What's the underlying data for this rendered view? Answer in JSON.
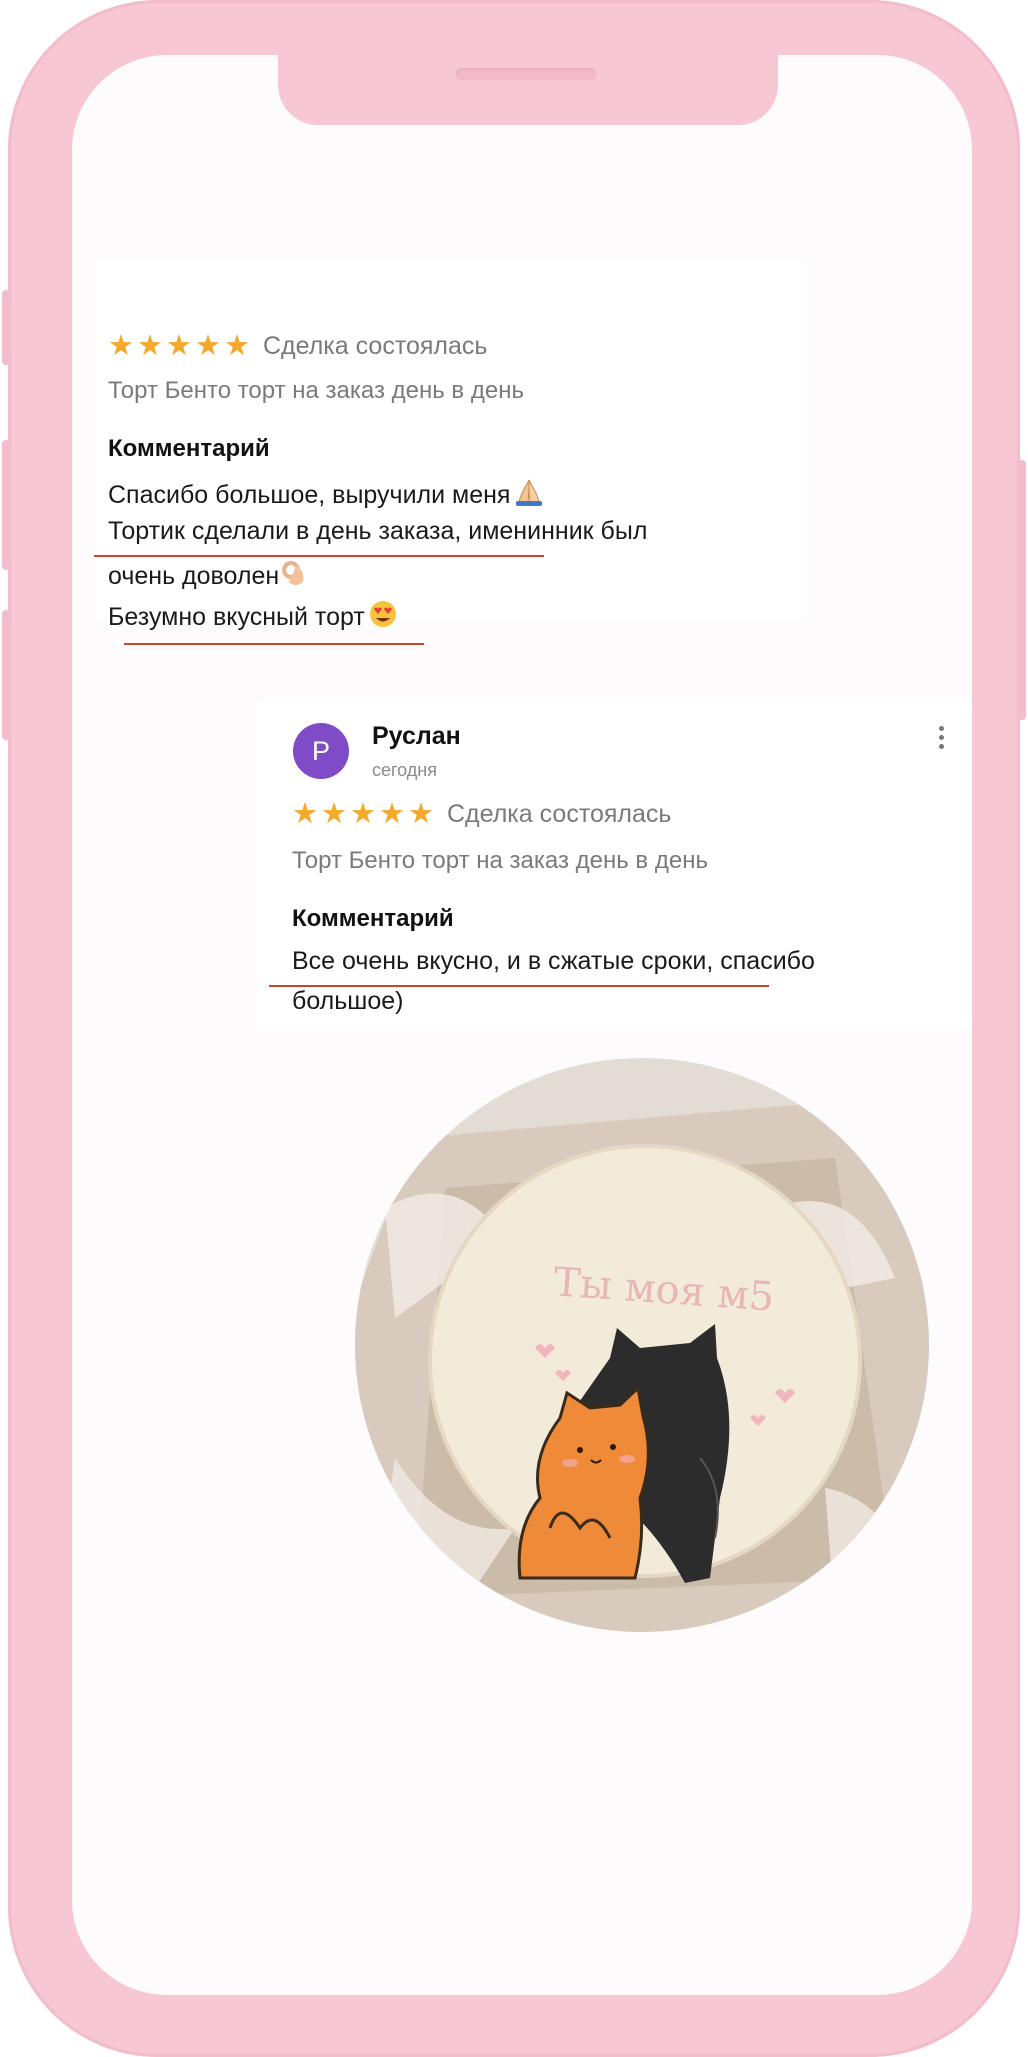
{
  "review1": {
    "rating": 5,
    "deal_status": "Сделка состоялась",
    "product": "Торт Бенто торт на заказ день в день",
    "comment_heading": "Комментарий",
    "comment_lines": [
      "Спасибо большое, выручили меня",
      "Тортик сделали в день заказа, именинник был",
      "очень доволен",
      "Безумно вкусный торт"
    ],
    "emojis": [
      "praying-hands-icon",
      "ok-hand-icon",
      "heart-eyes-icon"
    ]
  },
  "review2": {
    "avatar_letter": "Р",
    "author": "Руслан",
    "date": "сегодня",
    "rating": 5,
    "deal_status": "Сделка состоялась",
    "product": "Торт Бенто торт на заказ день в день",
    "comment_heading": "Комментарий",
    "comment_lines": [
      "Все очень вкусно, и в сжатые сроки, спасибо",
      "большое)"
    ]
  },
  "photo": {
    "cake_text": "Ты моя м5"
  },
  "colors": {
    "frame": "#f7c8d4",
    "star": "#f4a92a",
    "underline": "#d1402f",
    "avatar": "#7f4bc6"
  }
}
